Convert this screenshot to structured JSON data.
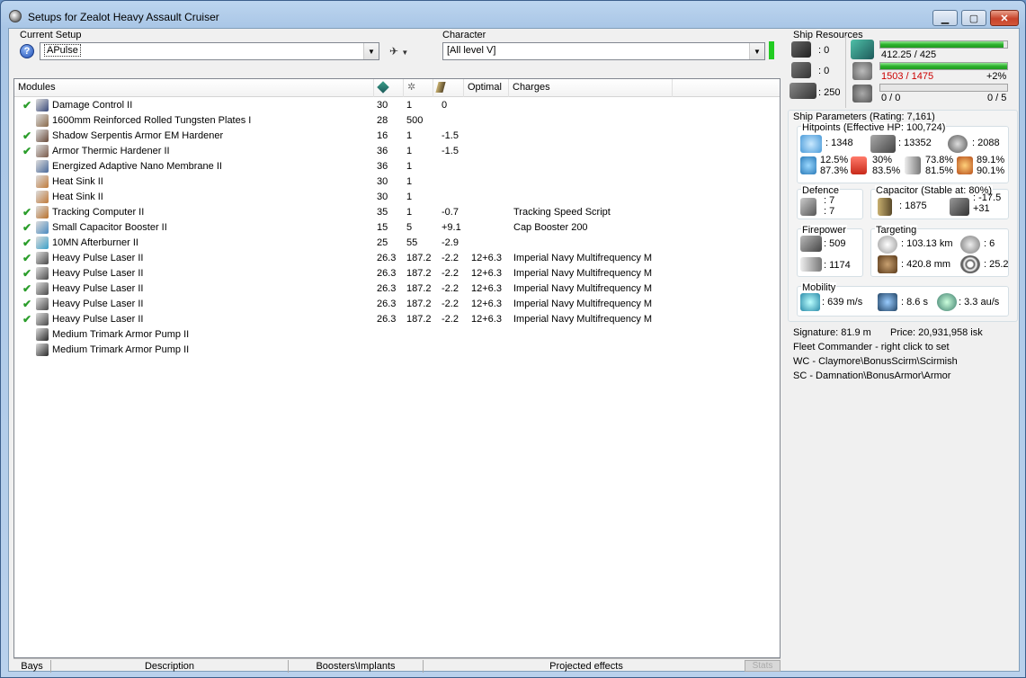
{
  "window": {
    "title": "Setups for Zealot Heavy Assault Cruiser",
    "minimize": "▁",
    "maximize": "▢",
    "close": "✕"
  },
  "setup": {
    "label": "Current Setup",
    "value": "APulse"
  },
  "character": {
    "label": "Character",
    "value": "[All level V]"
  },
  "grid": {
    "headers": [
      "Modules",
      "",
      "",
      "",
      "Optimal",
      "Charges"
    ],
    "rows": [
      {
        "check": "✔",
        "name": "Damage Control II",
        "c1": "30",
        "c2": "1",
        "c3": "0",
        "opt": "",
        "charge": "",
        "color": "#3a4a7a"
      },
      {
        "check": "",
        "name": "1600mm Reinforced Rolled Tungsten Plates I",
        "c1": "28",
        "c2": "500",
        "c3": "",
        "opt": "",
        "charge": "",
        "color": "#8a6a4a"
      },
      {
        "check": "✔",
        "name": "Shadow Serpentis Armor EM Hardener",
        "c1": "16",
        "c2": "1",
        "c3": "-1.5",
        "opt": "",
        "charge": "",
        "color": "#6a4a3a"
      },
      {
        "check": "✔",
        "name": "Armor Thermic Hardener II",
        "c1": "36",
        "c2": "1",
        "c3": "-1.5",
        "opt": "",
        "charge": "",
        "color": "#7a5a4a"
      },
      {
        "check": "",
        "name": "Energized Adaptive Nano Membrane II",
        "c1": "36",
        "c2": "1",
        "c3": "",
        "opt": "",
        "charge": "",
        "color": "#4a6a9a"
      },
      {
        "check": "",
        "name": "Heat Sink II",
        "c1": "30",
        "c2": "1",
        "c3": "",
        "opt": "",
        "charge": "",
        "color": "#c07a3a"
      },
      {
        "check": "",
        "name": "Heat Sink II",
        "c1": "30",
        "c2": "1",
        "c3": "",
        "opt": "",
        "charge": "",
        "color": "#c07a3a"
      },
      {
        "check": "✔",
        "name": "Tracking Computer II",
        "c1": "35",
        "c2": "1",
        "c3": "-0.7",
        "opt": "",
        "charge": "Tracking Speed Script",
        "color": "#b8702a"
      },
      {
        "check": "✔",
        "name": "Small Capacitor Booster II",
        "c1": "15",
        "c2": "5",
        "c3": "+9.1",
        "opt": "",
        "charge": "Cap Booster 200",
        "color": "#4a8abf"
      },
      {
        "check": "✔",
        "name": "10MN Afterburner II",
        "c1": "25",
        "c2": "55",
        "c3": "-2.9",
        "opt": "",
        "charge": "",
        "color": "#3aa0c8"
      },
      {
        "check": "✔",
        "name": "Heavy Pulse Laser II",
        "c1": "26.3",
        "c2": "187.2",
        "c3": "-2.2",
        "opt": "12+6.3",
        "charge": "Imperial Navy Multifrequency M",
        "color": "#4a4a4a"
      },
      {
        "check": "✔",
        "name": "Heavy Pulse Laser II",
        "c1": "26.3",
        "c2": "187.2",
        "c3": "-2.2",
        "opt": "12+6.3",
        "charge": "Imperial Navy Multifrequency M",
        "color": "#4a4a4a"
      },
      {
        "check": "✔",
        "name": "Heavy Pulse Laser II",
        "c1": "26.3",
        "c2": "187.2",
        "c3": "-2.2",
        "opt": "12+6.3",
        "charge": "Imperial Navy Multifrequency M",
        "color": "#4a4a4a"
      },
      {
        "check": "✔",
        "name": "Heavy Pulse Laser II",
        "c1": "26.3",
        "c2": "187.2",
        "c3": "-2.2",
        "opt": "12+6.3",
        "charge": "Imperial Navy Multifrequency M",
        "color": "#4a4a4a"
      },
      {
        "check": "✔",
        "name": "Heavy Pulse Laser II",
        "c1": "26.3",
        "c2": "187.2",
        "c3": "-2.2",
        "opt": "12+6.3",
        "charge": "Imperial Navy Multifrequency M",
        "color": "#4a4a4a"
      },
      {
        "check": "",
        "name": "Medium Trimark Armor Pump II",
        "c1": "",
        "c2": "",
        "c3": "",
        "opt": "",
        "charge": "",
        "color": "#2a2a2a"
      },
      {
        "check": "",
        "name": "Medium Trimark Armor Pump II",
        "c1": "",
        "c2": "",
        "c3": "",
        "opt": "",
        "charge": "",
        "color": "#2a2a2a"
      }
    ]
  },
  "tabs": {
    "bays": "Bays",
    "description": "Description",
    "boosters": "Boosters\\Implants",
    "projected": "Projected effects",
    "stats": "Stats"
  },
  "resources": {
    "title": "Ship Resources",
    "hi": ": 0",
    "med": ": 0",
    "drone": ": 250",
    "cpu": "412.25 / 425",
    "cpu_fill": 0.97,
    "pg": "1503 / 1475",
    "pg_pct": "+2%",
    "pg_fill": 1.0,
    "cal": "0 / 0",
    "cal_right": "0 / 5",
    "cal_fill": 0.0
  },
  "params": {
    "title": "Ship Parameters (Rating: 7,161)",
    "hp_title": "Hitpoints (Effective HP: 100,724)",
    "shield_hp": ": 1348",
    "armor_hp": ": 13352",
    "struct_hp": ": 2088",
    "em_a": "12.5%",
    "em_b": "87.3%",
    "th_a": "30%",
    "th_b": "83.5%",
    "ki_a": "73.8%",
    "ki_b": "81.5%",
    "ex_a": "89.1%",
    "ex_b": "90.1%",
    "def_title": "Defence",
    "def_a": ": 7",
    "def_b": ": 7",
    "cap_title": "Capacitor (Stable at: 80%)",
    "cap_val": ": 1875",
    "cap_a": ": -17.5",
    "cap_b": "+31",
    "fp_title": "Firepower",
    "fp_a": ": 509",
    "fp_b": ": 1174",
    "tg_title": "Targeting",
    "tg_range": ": 103.13 km",
    "tg_count": ": 6",
    "tg_res": ": 420.8 mm",
    "tg_sig": ": 25.2",
    "mob_title": "Mobility",
    "speed": ": 639 m/s",
    "align": ": 8.6 s",
    "warp": ": 3.3 au/s"
  },
  "info": {
    "signature": "Signature: 81.9 m",
    "price": "Price: 20,931,958 isk",
    "fleet": "Fleet Commander - right click to set",
    "wc": "WC - Claymore\\BonusScirm\\Scirmish",
    "sc": "SC - Damnation\\BonusArmor\\Armor"
  }
}
